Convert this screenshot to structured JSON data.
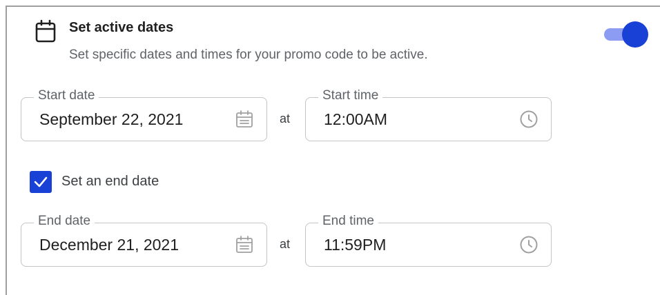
{
  "section": {
    "title": "Set active dates",
    "description": "Set specific dates and times for your promo code to be active.",
    "header_icon": "calendar-icon",
    "toggle_on": true
  },
  "start": {
    "date_label": "Start date",
    "date_value": "September 22, 2021",
    "connector": "at",
    "time_label": "Start time",
    "time_value": "12:00AM"
  },
  "end_toggle": {
    "checked": true,
    "label": "Set an end date"
  },
  "end": {
    "date_label": "End date",
    "date_value": "December 21, 2021",
    "connector": "at",
    "time_label": "End time",
    "time_value": "11:59PM"
  },
  "icons": {
    "date_field": "calendar-icon",
    "time_field": "clock-icon",
    "checkbox": "check-icon"
  },
  "colors": {
    "accent": "#1a41d6",
    "toggle_track": "#8c9cf2",
    "field_border": "#c4c4c4",
    "muted_text": "#5f6368"
  }
}
